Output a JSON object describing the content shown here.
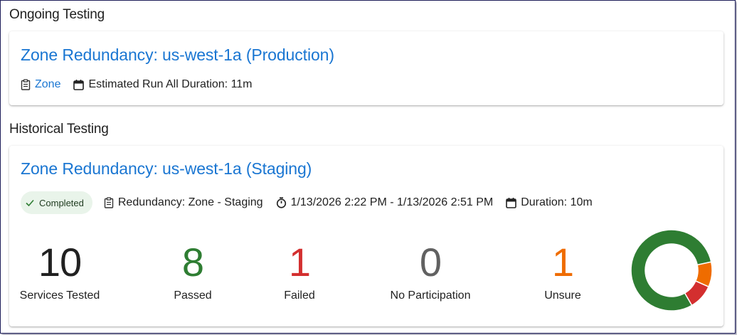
{
  "ongoing": {
    "heading": "Ongoing Testing",
    "card": {
      "title": "Zone Redundancy: us-west-1a (Production)",
      "type_link": "Zone",
      "duration": "Estimated Run All Duration: 11m"
    }
  },
  "historical": {
    "heading": "Historical Testing",
    "card": {
      "title": "Zone Redundancy: us-west-1a (Staging)",
      "status": "Completed",
      "scenario": "Redundancy: Zone - Staging",
      "time_range": "1/13/2026 2:22 PM - 1/13/2026 2:51 PM",
      "duration": "Duration: 10m",
      "stats": [
        {
          "value": "10",
          "label": "Services Tested",
          "color": "#212121"
        },
        {
          "value": "8",
          "label": "Passed",
          "color": "#2e7d32"
        },
        {
          "value": "1",
          "label": "Failed",
          "color": "#d32f2f"
        },
        {
          "value": "0",
          "label": "No Participation",
          "color": "#616161"
        },
        {
          "value": "1",
          "label": "Unsure",
          "color": "#ef6c00"
        }
      ]
    }
  },
  "chart_data": {
    "type": "pie",
    "donut": true,
    "categories": [
      "Passed",
      "Failed",
      "Unsure"
    ],
    "values": [
      8,
      1,
      1
    ],
    "colors": [
      "#2e7d32",
      "#d32f2f",
      "#ef6c00"
    ]
  },
  "icons": {
    "clipboard": "clipboard-icon",
    "calendar": "calendar-icon",
    "timer": "timer-icon",
    "check": "check-icon"
  }
}
